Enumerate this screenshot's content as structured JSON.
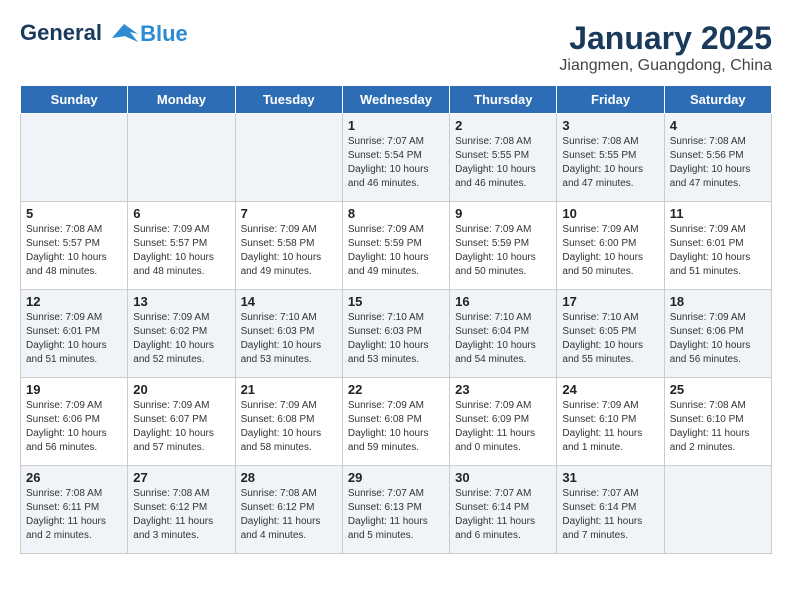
{
  "header": {
    "logo_line1": "General",
    "logo_line2": "Blue",
    "title": "January 2025",
    "subtitle": "Jiangmen, Guangdong, China"
  },
  "days_of_week": [
    "Sunday",
    "Monday",
    "Tuesday",
    "Wednesday",
    "Thursday",
    "Friday",
    "Saturday"
  ],
  "weeks": [
    [
      {
        "day": "",
        "info": ""
      },
      {
        "day": "",
        "info": ""
      },
      {
        "day": "",
        "info": ""
      },
      {
        "day": "1",
        "info": "Sunrise: 7:07 AM\nSunset: 5:54 PM\nDaylight: 10 hours\nand 46 minutes."
      },
      {
        "day": "2",
        "info": "Sunrise: 7:08 AM\nSunset: 5:55 PM\nDaylight: 10 hours\nand 46 minutes."
      },
      {
        "day": "3",
        "info": "Sunrise: 7:08 AM\nSunset: 5:55 PM\nDaylight: 10 hours\nand 47 minutes."
      },
      {
        "day": "4",
        "info": "Sunrise: 7:08 AM\nSunset: 5:56 PM\nDaylight: 10 hours\nand 47 minutes."
      }
    ],
    [
      {
        "day": "5",
        "info": "Sunrise: 7:08 AM\nSunset: 5:57 PM\nDaylight: 10 hours\nand 48 minutes."
      },
      {
        "day": "6",
        "info": "Sunrise: 7:09 AM\nSunset: 5:57 PM\nDaylight: 10 hours\nand 48 minutes."
      },
      {
        "day": "7",
        "info": "Sunrise: 7:09 AM\nSunset: 5:58 PM\nDaylight: 10 hours\nand 49 minutes."
      },
      {
        "day": "8",
        "info": "Sunrise: 7:09 AM\nSunset: 5:59 PM\nDaylight: 10 hours\nand 49 minutes."
      },
      {
        "day": "9",
        "info": "Sunrise: 7:09 AM\nSunset: 5:59 PM\nDaylight: 10 hours\nand 50 minutes."
      },
      {
        "day": "10",
        "info": "Sunrise: 7:09 AM\nSunset: 6:00 PM\nDaylight: 10 hours\nand 50 minutes."
      },
      {
        "day": "11",
        "info": "Sunrise: 7:09 AM\nSunset: 6:01 PM\nDaylight: 10 hours\nand 51 minutes."
      }
    ],
    [
      {
        "day": "12",
        "info": "Sunrise: 7:09 AM\nSunset: 6:01 PM\nDaylight: 10 hours\nand 51 minutes."
      },
      {
        "day": "13",
        "info": "Sunrise: 7:09 AM\nSunset: 6:02 PM\nDaylight: 10 hours\nand 52 minutes."
      },
      {
        "day": "14",
        "info": "Sunrise: 7:10 AM\nSunset: 6:03 PM\nDaylight: 10 hours\nand 53 minutes."
      },
      {
        "day": "15",
        "info": "Sunrise: 7:10 AM\nSunset: 6:03 PM\nDaylight: 10 hours\nand 53 minutes."
      },
      {
        "day": "16",
        "info": "Sunrise: 7:10 AM\nSunset: 6:04 PM\nDaylight: 10 hours\nand 54 minutes."
      },
      {
        "day": "17",
        "info": "Sunrise: 7:10 AM\nSunset: 6:05 PM\nDaylight: 10 hours\nand 55 minutes."
      },
      {
        "day": "18",
        "info": "Sunrise: 7:09 AM\nSunset: 6:06 PM\nDaylight: 10 hours\nand 56 minutes."
      }
    ],
    [
      {
        "day": "19",
        "info": "Sunrise: 7:09 AM\nSunset: 6:06 PM\nDaylight: 10 hours\nand 56 minutes."
      },
      {
        "day": "20",
        "info": "Sunrise: 7:09 AM\nSunset: 6:07 PM\nDaylight: 10 hours\nand 57 minutes."
      },
      {
        "day": "21",
        "info": "Sunrise: 7:09 AM\nSunset: 6:08 PM\nDaylight: 10 hours\nand 58 minutes."
      },
      {
        "day": "22",
        "info": "Sunrise: 7:09 AM\nSunset: 6:08 PM\nDaylight: 10 hours\nand 59 minutes."
      },
      {
        "day": "23",
        "info": "Sunrise: 7:09 AM\nSunset: 6:09 PM\nDaylight: 11 hours\nand 0 minutes."
      },
      {
        "day": "24",
        "info": "Sunrise: 7:09 AM\nSunset: 6:10 PM\nDaylight: 11 hours\nand 1 minute."
      },
      {
        "day": "25",
        "info": "Sunrise: 7:08 AM\nSunset: 6:10 PM\nDaylight: 11 hours\nand 2 minutes."
      }
    ],
    [
      {
        "day": "26",
        "info": "Sunrise: 7:08 AM\nSunset: 6:11 PM\nDaylight: 11 hours\nand 2 minutes."
      },
      {
        "day": "27",
        "info": "Sunrise: 7:08 AM\nSunset: 6:12 PM\nDaylight: 11 hours\nand 3 minutes."
      },
      {
        "day": "28",
        "info": "Sunrise: 7:08 AM\nSunset: 6:12 PM\nDaylight: 11 hours\nand 4 minutes."
      },
      {
        "day": "29",
        "info": "Sunrise: 7:07 AM\nSunset: 6:13 PM\nDaylight: 11 hours\nand 5 minutes."
      },
      {
        "day": "30",
        "info": "Sunrise: 7:07 AM\nSunset: 6:14 PM\nDaylight: 11 hours\nand 6 minutes."
      },
      {
        "day": "31",
        "info": "Sunrise: 7:07 AM\nSunset: 6:14 PM\nDaylight: 11 hours\nand 7 minutes."
      },
      {
        "day": "",
        "info": ""
      }
    ]
  ]
}
